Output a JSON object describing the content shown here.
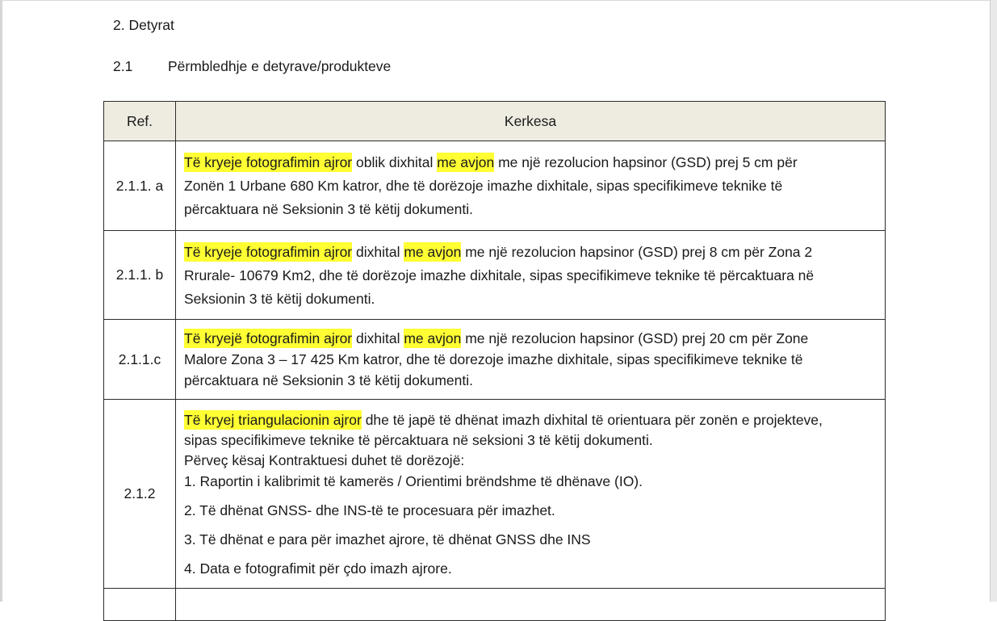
{
  "section": {
    "title": "2. Detyrat"
  },
  "subsection": {
    "number": "2.1",
    "title": "Përmbledhje e detyrave/produkteve"
  },
  "table": {
    "headers": {
      "ref": "Ref.",
      "kerkesa": "Kerkesa"
    },
    "highlight_color": "#ffff33",
    "rows": [
      {
        "ref": "2.1.1. a",
        "l1_hl": "Të kryeje fotografimin ajror",
        "l1_a": " oblik dixhital ",
        "l1_hl2": "me avjon",
        "l1_b": " me një rezolucion hapsinor (GSD) prej 5 cm për",
        "l2": "Zonën 1 Urbane 680 Km katror, dhe të dorëzoje imazhe dixhitale, sipas specifikimeve teknike të",
        "l3": "përcaktuara në Seksionin 3 të këtij dokumenti."
      },
      {
        "ref": "2.1.1. b",
        "l1_hl": "Të kryeje fotografimin ajror",
        "l1_a": " dixhital ",
        "l1_hl2": "me avjon",
        "l1_b": " me një rezolucion hapsinor (GSD) prej 8 cm për Zona 2",
        "l2": "Rrurale- 10679 Km2, dhe të dorëzoje imazhe dixhitale, sipas specifikimeve teknike të përcaktuara në",
        "l3": "Seksionin 3 të këtij dokumenti."
      },
      {
        "ref": "2.1.1.c",
        "l1_hl": "Të kryejë fotografimin ajror",
        "l1_a": " dixhital ",
        "l1_hl2": "me avjon",
        "l1_b": " me një rezolucion hapsinor (GSD) prej 20 cm për Zone",
        "l2": "Malore Zona 3 – 17 425 Km katror, dhe të dorezoje imazhe dixhitale, sipas specifikimeve teknike të",
        "l3": "përcaktuara në Seksionin 3 të këtij dokumenti."
      },
      {
        "ref": "2.1.2",
        "l1_hl": "Të kryej triangulacionin ajror",
        "l1_a": " dhe të japë të dhënat imazh dixhital të orientuara për zonën e projekteve,",
        "l2": "sipas specifikimeve teknike të përcaktuara në seksioni 3 të këtij dokumenti.",
        "l3": "Përveç kësaj Kontraktuesi duhet të dorëzojë:",
        "items": [
          "1. Raportin i kalibrimit të kamerës / Orientimi brëndshme të dhënave (IO).",
          "2. Të dhënat GNSS- dhe INS-të te procesuara për imazhet.",
          "3. Të dhënat e para për imazhet ajrore, të dhënat GNSS dhe INS",
          "4. Data e fotografimit për çdo imazh ajrore."
        ]
      }
    ]
  }
}
